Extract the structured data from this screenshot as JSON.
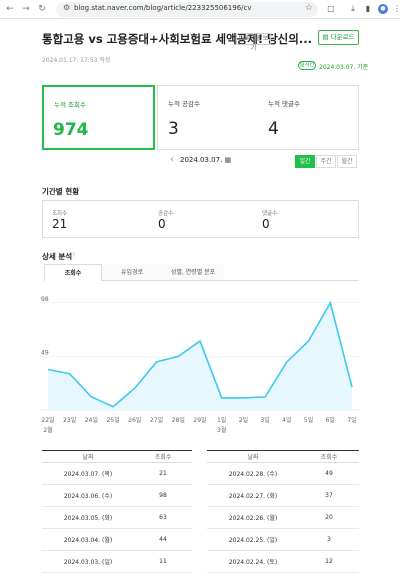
{
  "browser": {
    "url": "blog.stat.naver.com/blog/article/223325506196/cv"
  },
  "header": {
    "title": "통합고용 vs 고용증대+사회보험료 세액공제! 당신의...",
    "view_label": "미게시물 보기",
    "download_label": "다운로드",
    "written_date": "2024.01.17. 17:53 작성",
    "realtime_badge": "실시간",
    "realtime_time": "2024.03.07. 기준"
  },
  "summary": {
    "views_label": "누적 조회수",
    "views_value": "974",
    "likes_label": "누적 공감수",
    "likes_value": "3",
    "comments_label": "누적 댓글수",
    "comments_value": "4"
  },
  "date_nav": {
    "date": "2024.03.07.",
    "periods": [
      "일간",
      "주간",
      "월간"
    ]
  },
  "period_stats": {
    "title": "기간별 현황",
    "views_label": "조회수",
    "views_value": "21",
    "likes_label": "공감수",
    "likes_value": "0",
    "comments_label": "댓글수",
    "comments_value": "0"
  },
  "detail": {
    "title": "상세 분석",
    "tabs": [
      "조회수",
      "유입경로",
      "성별, 연령별 분포"
    ]
  },
  "chart_data": {
    "type": "line",
    "x": [
      "22일",
      "23일",
      "24일",
      "25일",
      "26일",
      "27일",
      "28일",
      "29일",
      "1일",
      "2일",
      "3일",
      "4일",
      "5일",
      "6일",
      "7일"
    ],
    "x_sub": [
      "2월",
      "",
      "",
      "",
      "",
      "",
      "",
      "",
      "3월",
      "",
      "",
      "",
      "",
      "",
      ""
    ],
    "values": [
      37,
      33,
      12,
      3,
      20,
      44,
      49,
      63,
      11,
      11,
      12,
      44,
      63,
      98,
      21
    ],
    "yticks": [
      49,
      98
    ],
    "ylim": [
      0,
      106
    ],
    "colors": {
      "line": "#3fc8f0",
      "fill": "#e6f7fd"
    }
  },
  "table": {
    "headers": [
      "날짜",
      "조회수"
    ],
    "left": [
      {
        "date": "2024.03.07. (목)",
        "views": "21"
      },
      {
        "date": "2024.03.06. (수)",
        "views": "98"
      },
      {
        "date": "2024.03.05. (화)",
        "views": "63"
      },
      {
        "date": "2024.03.04. (월)",
        "views": "44"
      },
      {
        "date": "2024.03.03. (일)",
        "views": "11"
      }
    ],
    "right": [
      {
        "date": "2024.02.28. (수)",
        "views": "49"
      },
      {
        "date": "2024.02.27. (화)",
        "views": "37"
      },
      {
        "date": "2024.02.26. (월)",
        "views": "20"
      },
      {
        "date": "2024.02.25. (일)",
        "views": "3"
      },
      {
        "date": "2024.02.24. (토)",
        "views": "12"
      }
    ]
  }
}
